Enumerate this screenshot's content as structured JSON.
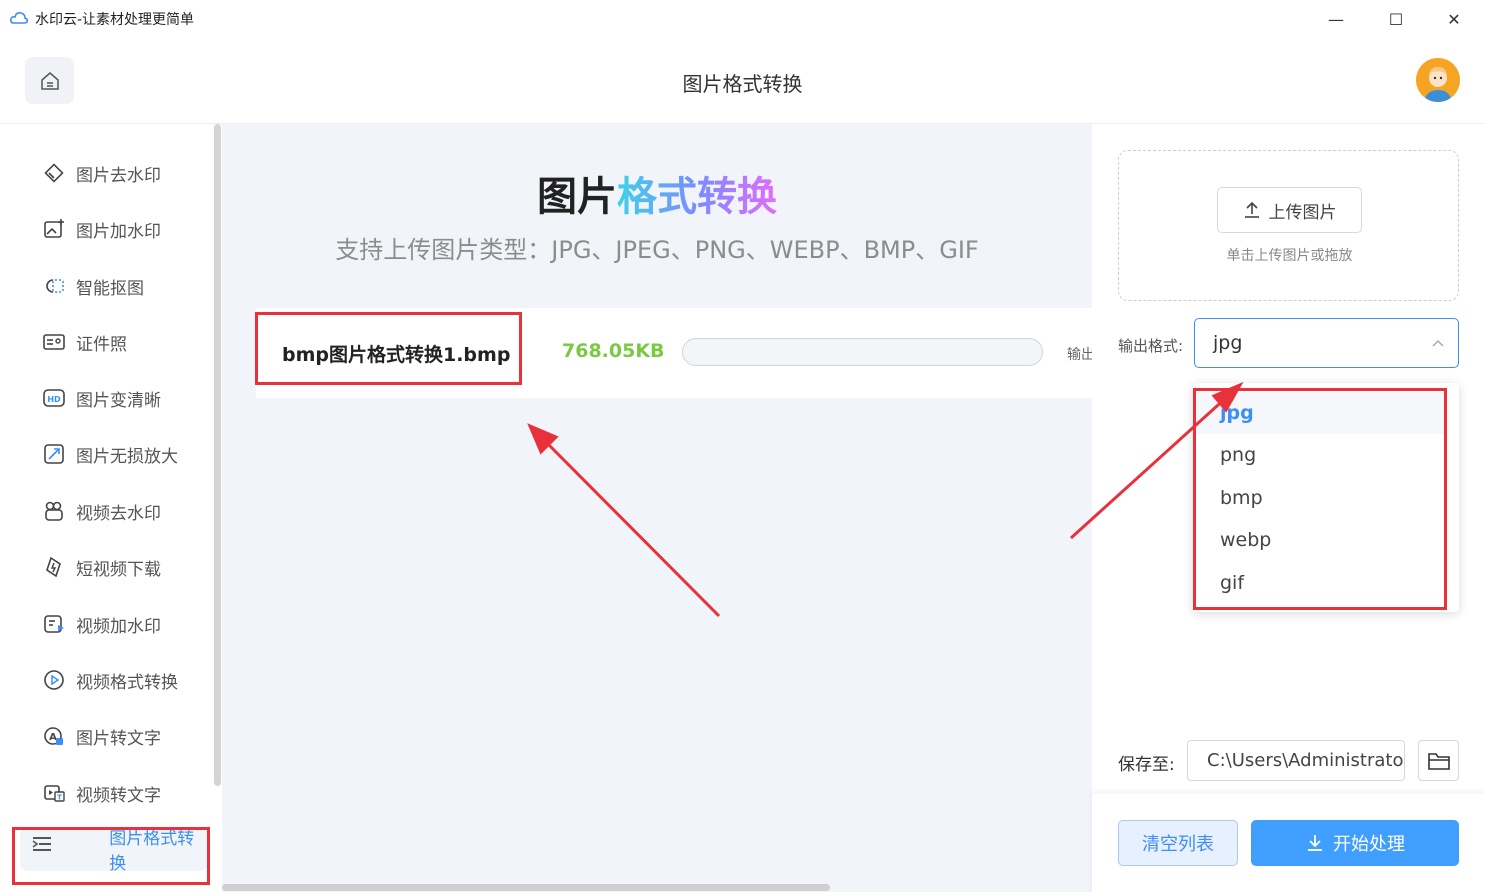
{
  "window": {
    "title": "水印云-让素材处理更简单",
    "controls": [
      "—",
      "☐",
      "✕"
    ]
  },
  "header": {
    "title": "图片格式转换",
    "home_icon": "home-icon",
    "avatar_icon": "user-avatar"
  },
  "sidebar": {
    "items": [
      {
        "label": "图片去水印",
        "icon": "eraser-icon"
      },
      {
        "label": "图片加水印",
        "icon": "image-add-icon"
      },
      {
        "label": "智能抠图",
        "icon": "cutout-icon"
      },
      {
        "label": "证件照",
        "icon": "id-card-icon"
      },
      {
        "label": "图片变清晰",
        "icon": "hd-icon"
      },
      {
        "label": "图片无损放大",
        "icon": "enlarge-icon"
      },
      {
        "label": "视频去水印",
        "icon": "video-eraser-icon"
      },
      {
        "label": "短视频下载",
        "icon": "download-icon"
      },
      {
        "label": "视频加水印",
        "icon": "video-add-icon"
      },
      {
        "label": "视频格式转换",
        "icon": "play-icon"
      },
      {
        "label": "图片转文字",
        "icon": "ocr-icon"
      },
      {
        "label": "视频转文字",
        "icon": "video-text-icon"
      },
      {
        "label": "图片格式转换",
        "icon": "convert-icon",
        "active": true
      }
    ]
  },
  "main": {
    "hero_part1": "图片",
    "hero_part2": "格式转换",
    "subtitle": "支持上传图片类型：JPG、JPEG、PNG、WEBP、BMP、GIF",
    "file": {
      "name": "bmp图片格式转换1.bmp",
      "size": "768.05KB",
      "progress": 0,
      "output_label": "输出"
    }
  },
  "right": {
    "upload_label": "上传图片",
    "upload_hint": "单击上传图片或拖放",
    "format_label": "输出格式:",
    "format_value": "jpg",
    "format_options": [
      "jpg",
      "png",
      "bmp",
      "webp",
      "gif"
    ],
    "save_label": "保存至:",
    "save_path": "C:\\Users\\Administrator",
    "clear_label": "清空列表",
    "start_label": "开始处理"
  },
  "colors": {
    "accent": "#409eff",
    "annotation": "#e8313a",
    "size_green": "#7ac943"
  }
}
